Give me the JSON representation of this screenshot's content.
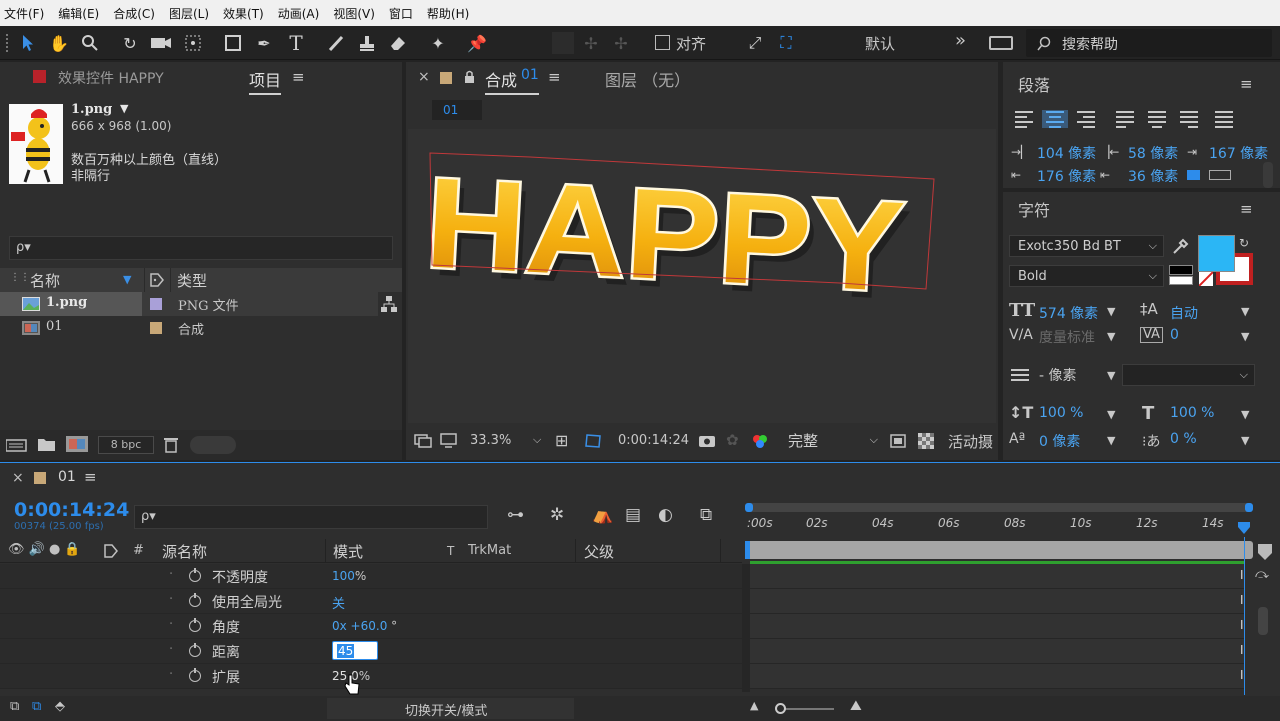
{
  "menu": [
    "文件(F)",
    "编辑(E)",
    "合成(C)",
    "图层(L)",
    "效果(T)",
    "动画(A)",
    "视图(V)",
    "窗口",
    "帮助(H)"
  ],
  "toolbar": {
    "align_label": "对齐",
    "workspace": "默认",
    "search_placeholder": "搜索帮助",
    "workspace_more": "»"
  },
  "left_panel": {
    "tab_effects": "效果控件 HAPPY",
    "tab_project": "项目",
    "file_name": "1.png",
    "file_dims": "666 x 968 (1.00)",
    "file_color": "数百万种以上颜色（直线）",
    "file_interlace": "非隔行",
    "search_placeholder": "ρ▾",
    "col_name": "名称",
    "col_type": "类型",
    "items": [
      {
        "name": "1.png",
        "type": "PNG 文件",
        "color": "#a9a0d8"
      },
      {
        "name": "01",
        "type": "合成",
        "color": "#c8a878"
      }
    ],
    "bpc": "8 bpc"
  },
  "viewer": {
    "tab_comp": "合成",
    "tab_comp_id": "01",
    "tab_layer": "图层 （无）",
    "breadcrumb": "01",
    "text": "HAPPY",
    "zoom": "33.3%",
    "timecode": "0:00:14:24",
    "quality": "完整",
    "camera": "活动摄"
  },
  "paragraph": {
    "title": "段落",
    "indent_left": "104 像素",
    "indent_right": "58 像素",
    "indent_first": "167 像素",
    "space_before": "176 像素",
    "space_after": "36 像素"
  },
  "character": {
    "title": "字符",
    "font": "Exotc350 Bd BT",
    "style": "Bold",
    "size": "574 像素",
    "leading": "自动",
    "kerning": "度量标准",
    "tracking": "0",
    "stroke_width": "- 像素",
    "vscale": "100 %",
    "hscale": "100 %",
    "baseline": "0 像素",
    "tsume": "0 %",
    "fill_color": "#2bb6f5"
  },
  "timeline": {
    "comp_name": "01",
    "timecode": "0:00:14:24",
    "timecode_sub": "00374 (25.00 fps)",
    "search_placeholder": "ρ▾",
    "col_source": "源名称",
    "col_mode": "模式",
    "col_t": "T",
    "col_trkmat": "TrkMat",
    "col_parent": "父级",
    "hash": "#",
    "ticks": [
      ":00s",
      "02s",
      "04s",
      "06s",
      "08s",
      "10s",
      "12s",
      "14s"
    ],
    "properties": [
      {
        "name": "不透明度",
        "value": "100",
        "unit": "%"
      },
      {
        "name": "使用全局光",
        "value": "关",
        "unit": ""
      },
      {
        "name": "角度",
        "value": "0x +60.0",
        "unit": " °"
      },
      {
        "name": "距离",
        "value": "45",
        "unit": ""
      },
      {
        "name": "扩展",
        "value": "25.0",
        "unit": "%"
      }
    ],
    "footer": "切换开关/模式"
  }
}
